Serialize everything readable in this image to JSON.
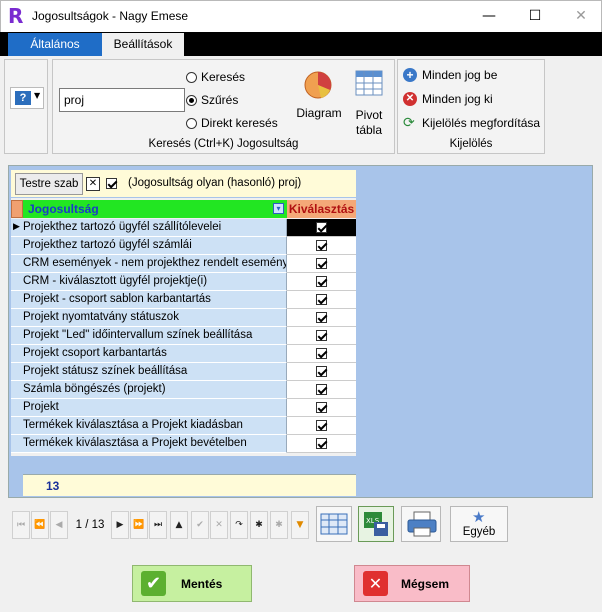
{
  "window": {
    "app_letter": "R",
    "title": "Jogosultságok - Nagy Emese",
    "minimize": "—",
    "maximize": "☐",
    "close": "✕"
  },
  "tabs": [
    "Általános",
    "Beállítások"
  ],
  "ribbon": {
    "search_value": "proj",
    "radios": [
      {
        "label": "Keresés",
        "selected": false
      },
      {
        "label": "Szűrés",
        "selected": true
      },
      {
        "label": "Direkt keresés",
        "selected": false
      }
    ],
    "diagram_label": "Diagram",
    "pivot_label_1": "Pivot",
    "pivot_label_2": "tábla",
    "search_caption": "Keresés (Ctrl+K) Jogosultság",
    "selection_caption": "Kijelölés",
    "selection_items": [
      "Minden jog be",
      "Minden jog ki",
      "Kijelölés megfordítása"
    ]
  },
  "filter": {
    "customize_label": "Testre szab",
    "clear_symbol": "✕",
    "filter_text": "(Jogosultság olyan (hasonló) proj)"
  },
  "grid": {
    "col_permission": "Jogosultság",
    "col_select": "Kiválasztás",
    "rows": [
      {
        "name": "Projekthez tartozó ügyfél szállítólevelei",
        "checked": true
      },
      {
        "name": "Projekthez tartozó ügyfél számlái",
        "checked": true
      },
      {
        "name": "CRM események - nem projekthez rendelt események",
        "checked": true
      },
      {
        "name": "CRM - kiválasztott ügyfél projektje(i)",
        "checked": true
      },
      {
        "name": "Projekt - csoport sablon karbantartás",
        "checked": true
      },
      {
        "name": "Projekt nyomtatvány státuszok",
        "checked": true
      },
      {
        "name": "Projekt \"Led\" időintervallum színek beállítása",
        "checked": true
      },
      {
        "name": "Projekt csoport karbantartás",
        "checked": true
      },
      {
        "name": "Projekt státusz színek beállítása",
        "checked": true
      },
      {
        "name": "Számla böngészés (projekt)",
        "checked": true
      },
      {
        "name": "Projekt",
        "checked": true
      },
      {
        "name": "Termékek kiválasztása a Projekt kiadásban",
        "checked": true
      },
      {
        "name": "Termékek kiválasztása a Projekt bevételben",
        "checked": true
      }
    ],
    "footer_count": "13"
  },
  "navigator": {
    "position": "1 / 13",
    "other_label": "Egyéb"
  },
  "buttons": {
    "save": "Mentés",
    "cancel": "Mégsem"
  }
}
